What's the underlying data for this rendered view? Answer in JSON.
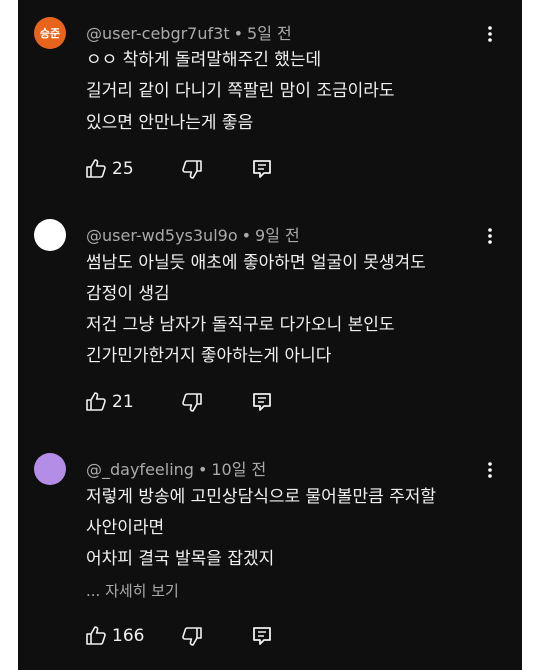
{
  "comments": [
    {
      "avatar_text": "승준",
      "avatar_color": "#e8641c",
      "username": "@user-cebgr7uf3t",
      "time": "5일 전",
      "lines": [
        "ㅇㅇ 착하게 돌려말해주긴 했는데",
        "길거리 같이 다니기 쪽팔린 맘이 조금이라도",
        "있으면 안만나는게 좋음"
      ],
      "likes": "25"
    },
    {
      "avatar_text": "",
      "avatar_color": "#ffffff",
      "username": "@user-wd5ys3ul9o",
      "time": "9일 전",
      "lines": [
        "썸남도 아닐듯 애초에 좋아하면 얼굴이 못생겨도",
        "감정이 생김",
        "저건 그냥 남자가 돌직구로 다가오니 본인도",
        "긴가민가한거지 좋아하는게 아니다"
      ],
      "likes": "21"
    },
    {
      "avatar_text": "",
      "avatar_color": "#b48ee6",
      "username": "@_dayfeeling",
      "time": "10일 전",
      "lines": [
        "저렇게 방송에 고민상담식으로 물어볼만큼 주저할",
        "사안이라면",
        "어차피 결국 발목을 잡겠지"
      ],
      "more_label": "... 자세히 보기",
      "likes": "166"
    }
  ],
  "icons": {
    "like": "thumbs-up-icon",
    "dislike": "thumbs-down-icon",
    "reply": "reply-icon",
    "menu": "more-vert-icon"
  }
}
